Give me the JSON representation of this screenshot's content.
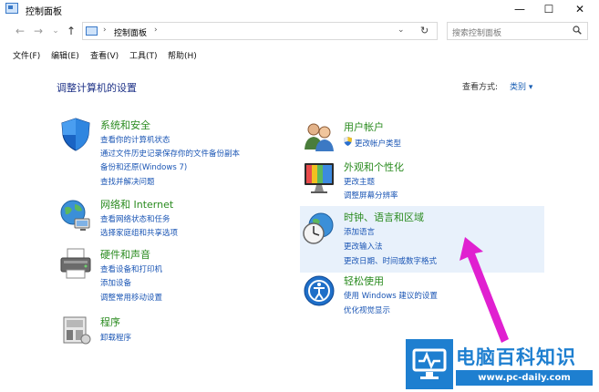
{
  "window": {
    "title": "控制面板",
    "controls": {
      "minimize": "—",
      "maximize": "☐",
      "close": "✕"
    }
  },
  "address": {
    "back": "←",
    "forward": "→",
    "dropdown": "⌄",
    "up": "↑",
    "path_separator": "›",
    "path": "控制面板",
    "refresh": "↻",
    "search_placeholder": "搜索控制面板"
  },
  "menu": [
    "文件(F)",
    "编辑(E)",
    "查看(V)",
    "工具(T)",
    "帮助(H)"
  ],
  "page_title": "调整计算机的设置",
  "view_by": {
    "label": "查看方式:",
    "value": "类别 ▾"
  },
  "categories_left": [
    {
      "title": "系统和安全",
      "icon": "shield-icon",
      "links": [
        "查看你的计算机状态",
        "通过文件历史记录保存你的文件备份副本",
        "备份和还原(Windows 7)",
        "查找并解决问题"
      ]
    },
    {
      "title": "网络和 Internet",
      "icon": "network-globe-icon",
      "links": [
        "查看网络状态和任务",
        "选择家庭组和共享选项"
      ]
    },
    {
      "title": "硬件和声音",
      "icon": "printer-icon",
      "links": [
        "查看设备和打印机",
        "添加设备",
        "调整常用移动设置"
      ]
    },
    {
      "title": "程序",
      "icon": "programs-icon",
      "links": [
        "卸载程序"
      ]
    }
  ],
  "categories_right": [
    {
      "title": "用户帐户",
      "icon": "users-icon",
      "links": [
        "更改帐户类型"
      ]
    },
    {
      "title": "外观和个性化",
      "icon": "monitor-icon",
      "links": [
        "更改主题",
        "调整屏幕分辨率"
      ]
    },
    {
      "title": "时钟、语言和区域",
      "icon": "clock-globe-icon",
      "links": [
        "添加语言",
        "更改输入法",
        "更改日期、时间或数字格式"
      ]
    },
    {
      "title": "轻松使用",
      "icon": "accessibility-icon",
      "links": [
        "使用 Windows 建议的设置",
        "优化视觉显示"
      ]
    }
  ],
  "watermark": {
    "title": "电脑百科知识",
    "url": "www.pc-daily.com"
  },
  "colors": {
    "category_title": "#2a8b1f",
    "link": "#1a55b4",
    "heading": "#1e3287",
    "arrow": "#e020d0",
    "brand": "#1e7fd0"
  }
}
